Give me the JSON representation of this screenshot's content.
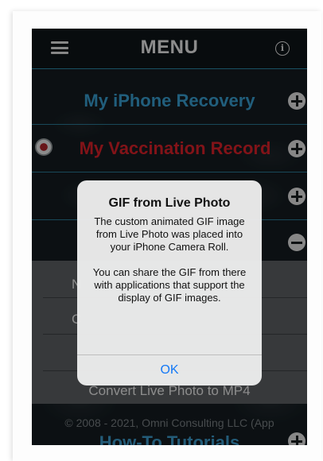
{
  "header": {
    "title": "MENU",
    "menu_icon": "hamburger-icon",
    "info_icon": "info-icon"
  },
  "menu_items": [
    {
      "label": "My iPhone Recovery",
      "color": "#39a3d6",
      "toggle": "plus-icon"
    },
    {
      "label": "My Vaccination Record",
      "color": "#e0222a",
      "toggle": "plus-icon"
    },
    {
      "label": "",
      "toggle": "plus-icon"
    },
    {
      "label": "",
      "toggle": "minus-icon"
    }
  ],
  "sub_items": [
    {
      "partial_label": "N"
    },
    {
      "partial_label": "C"
    }
  ],
  "convert_item": "Convert Live Photo to MP4",
  "footer": "© 2008 - 2021, Omni Consulting LLC (App",
  "tutorials": "How-To Tutorials",
  "alert": {
    "title": "GIF from Live Photo",
    "message": "The custom animated GIF image from Live Photo was placed into your iPhone Camera Roll.\n\nYou can share the GIF from there with applications that support the display of GIF images.",
    "ok_label": "OK"
  },
  "colors": {
    "accent_blue": "#39a3d6",
    "record_red": "#e0222a",
    "ios_link": "#1479f6"
  }
}
